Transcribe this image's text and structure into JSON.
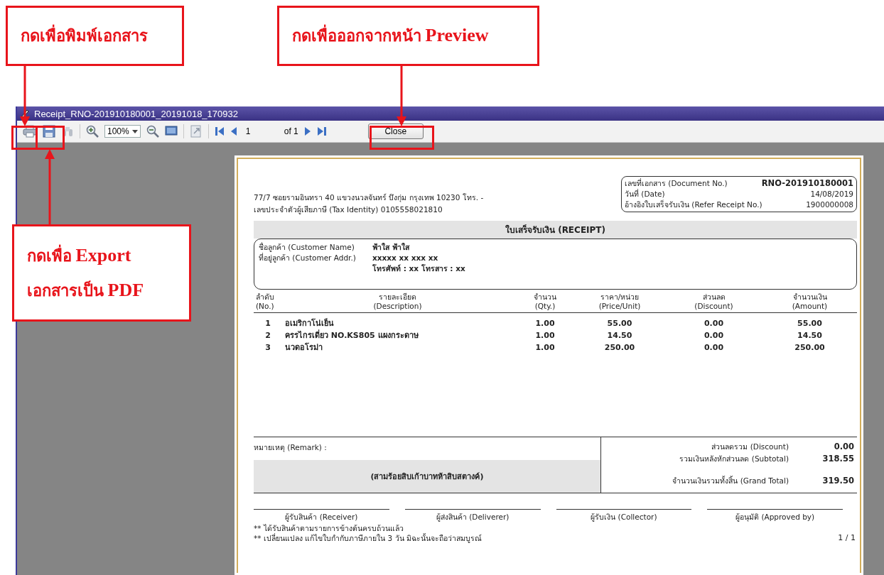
{
  "annotations": [
    {
      "kind": "print",
      "lines": [
        "กดเพื่อพิมพ์เอกสาร"
      ]
    },
    {
      "kind": "close",
      "lines": [
        "กดเพื่อออกจากหน้า **Preview**"
      ]
    },
    {
      "kind": "export",
      "lines": [
        "กดเพื่อ **Export**",
        "เอกสารเป็น **PDF**"
      ]
    }
  ],
  "window": {
    "title": "Receipt_RNO-201910180001_20191018_170932"
  },
  "toolbar": {
    "zoom": "100%",
    "page": "1",
    "page_total": "of 1",
    "close_button": "Close"
  },
  "document": {
    "company_lines": [
      "77/7 ซอยรามอินทรา 40 แขวงนวลจันทร์ บึงกุ่ม กรุงเทพ 10230 โทร. -",
      "เลขประจำตัวผู้เสียภาษี (Tax Identity) 0105558021810"
    ],
    "info": [
      {
        "label": "เลขที่เอกสาร (Document No.)",
        "value": "RNO-201910180001",
        "bold": true
      },
      {
        "label": "วันที่ (Date)",
        "value": "14/08/2019",
        "bold": false
      },
      {
        "label": "อ้างอิงใบเสร็จรับเงิน (Refer Receipt No.)",
        "value": "1900000008",
        "bold": false
      }
    ],
    "title": "ใบเสร็จรับเงิน   (RECEIPT)",
    "customer": [
      {
        "label": "ชื่อลูกค้า (Customer Name)",
        "values": [
          "ฟ้าใส    ฟ้าใส"
        ]
      },
      {
        "label": "ที่อยู่ลูกค้า (Customer Addr.)",
        "values": [
          "xxxxx xx xxx xx",
          "โทรศัพท์ : xx  โทรสาร : xx"
        ]
      }
    ],
    "columns": [
      {
        "th": "ลำดับ",
        "en": "(No.)"
      },
      {
        "th": "รายละเอียด",
        "en": "(Description)"
      },
      {
        "th": "จำนวน",
        "en": "(Qty.)"
      },
      {
        "th": "ราคา/หน่วย",
        "en": "(Price/Unit)"
      },
      {
        "th": "ส่วนลด",
        "en": "(Discount)"
      },
      {
        "th": "จำนวนเงิน",
        "en": "(Amount)"
      }
    ],
    "items": [
      {
        "no": "1",
        "description": "อเมริกาโน่เย็น",
        "qty": "1.00",
        "price": "55.00",
        "discount": "0.00",
        "amount": "55.00"
      },
      {
        "no": "2",
        "description": "ครรไกรเดี่ยว NO.KS805 แผงกระดาษ",
        "qty": "1.00",
        "price": "14.50",
        "discount": "0.00",
        "amount": "14.50"
      },
      {
        "no": "3",
        "description": "นวดอโรม่า",
        "qty": "1.00",
        "price": "250.00",
        "discount": "0.00",
        "amount": "250.00"
      }
    ],
    "remark_label": "หมายเหตุ (Remark) :",
    "amount_words": "(สามร้อยสิบเก้าบาทห้าสิบสตางค์)",
    "totals": [
      {
        "label": "ส่วนลดรวม (Discount)",
        "value": "0.00"
      },
      {
        "label": "รวมเงินหลังหักส่วนลด (Subtotal)",
        "value": "318.55"
      }
    ],
    "grand_total": {
      "label": "จำนวนเงินรวมทั้งสิ้น (Grand Total)",
      "value": "319.50"
    },
    "signatures": [
      "ผู้รับสินค้า (Receiver)",
      "ผู้ส่งสินค้า (Deliverer)",
      "ผู้รับเงิน (Collector)",
      "ผู้อนุมัติ (Approved by)"
    ],
    "notes": [
      "** ได้รับสินค้าตามรายการข้างต้นครบถ้วนแล้ว",
      "** เปลี่ยนแปลง แก้ไขใบกำกับภาษีภายใน 3 วัน มิฉะนั้นจะถือว่าสมบูรณ์"
    ],
    "page_indicator": "1 / 1"
  }
}
